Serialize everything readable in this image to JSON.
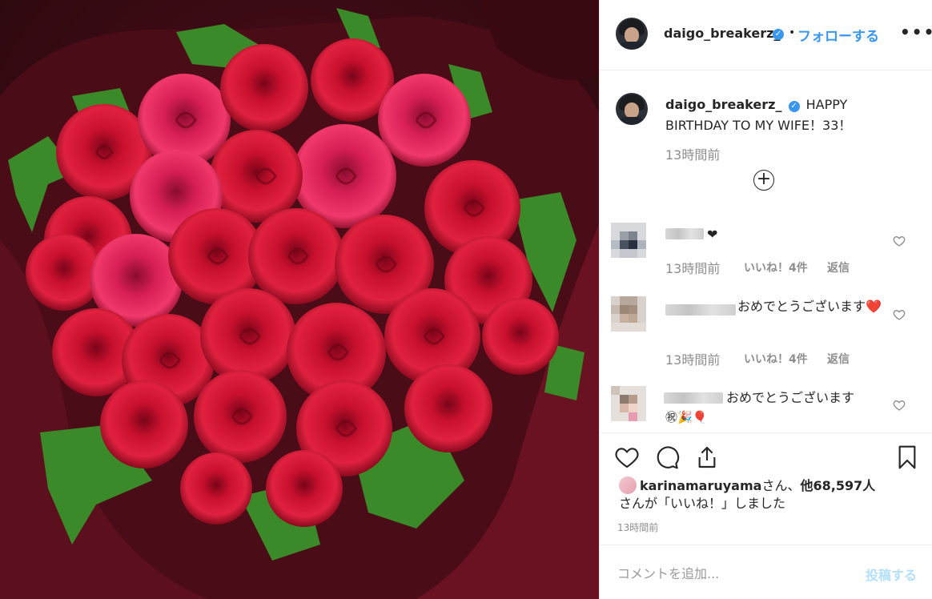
{
  "post": {
    "author": "daigo_breakerz_",
    "follow_label": "フォローする",
    "separator": "•",
    "more_label": "•••",
    "caption": "HAPPY BIRTHDAY TO MY WIFE！33！",
    "caption_time": "13時間前"
  },
  "comments": [
    {
      "text": "❤",
      "time": "13時間前",
      "likes": "いいね！4件",
      "reply": "返信"
    },
    {
      "text": "おめでとうございます❤️",
      "time": "13時間前",
      "likes": "いいね！4件",
      "reply": "返信"
    },
    {
      "text": "おめでとうございます",
      "emoji": "㊗🎉🎈"
    }
  ],
  "likes": {
    "user": "karinamaruyama",
    "suffix1": "さん、",
    "others": "他68,597人",
    "suffix2": "さんが「いいね！」しました"
  },
  "post_time": "13時間前",
  "comment_box": {
    "placeholder": "コメントを追加...",
    "post_label": "投稿する"
  },
  "colors": {
    "link_blue": "#3897f0",
    "verified_blue": "#3897f0",
    "muted": "#8e8e8e",
    "post_disabled": "#b2dffc"
  }
}
